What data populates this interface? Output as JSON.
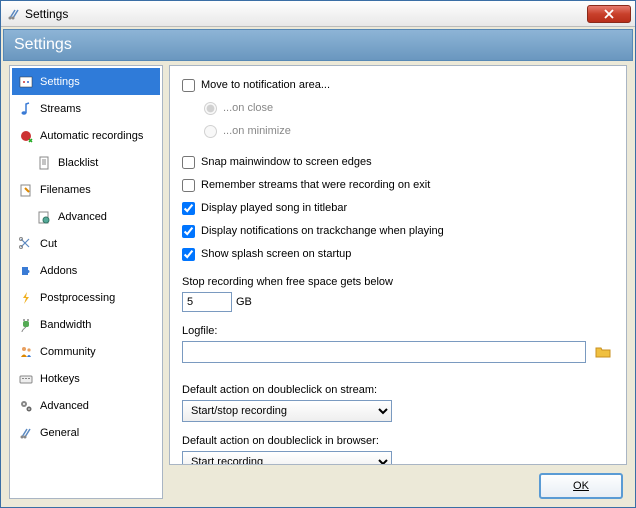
{
  "titlebar": {
    "title": "Settings"
  },
  "banner": {
    "title": "Settings"
  },
  "sidebar": {
    "items": [
      {
        "label": "Settings",
        "selected": true
      },
      {
        "label": "Streams"
      },
      {
        "label": "Automatic recordings"
      },
      {
        "label": "Blacklist",
        "sub": true
      },
      {
        "label": "Filenames"
      },
      {
        "label": "Advanced",
        "sub": true
      },
      {
        "label": "Cut"
      },
      {
        "label": "Addons"
      },
      {
        "label": "Postprocessing"
      },
      {
        "label": "Bandwidth"
      },
      {
        "label": "Community"
      },
      {
        "label": "Hotkeys"
      },
      {
        "label": "Advanced"
      },
      {
        "label": "General"
      }
    ]
  },
  "main": {
    "moveTray": {
      "label": "Move to notification area...",
      "checked": false
    },
    "moveTrayOnClose": {
      "label": "...on close",
      "checked": true
    },
    "moveTrayOnMin": {
      "label": "...on minimize",
      "checked": false
    },
    "snap": {
      "label": "Snap mainwindow to screen edges",
      "checked": false
    },
    "remember": {
      "label": "Remember streams that were recording on exit",
      "checked": false
    },
    "displaySong": {
      "label": "Display played song in titlebar",
      "checked": true
    },
    "displayNotif": {
      "label": "Display notifications on trackchange when playing",
      "checked": true
    },
    "splash": {
      "label": "Show splash screen on startup",
      "checked": true
    },
    "freespace": {
      "label": "Stop recording when free space gets below",
      "value": "5",
      "unit": "GB"
    },
    "logfile": {
      "label": "Logfile:",
      "value": ""
    },
    "dblStream": {
      "label": "Default action on doubleclick on stream:",
      "value": "Start/stop recording"
    },
    "dblBrowser": {
      "label": "Default action on doubleclick in browser:",
      "value": "Start recording"
    }
  },
  "footer": {
    "ok": "OK"
  }
}
